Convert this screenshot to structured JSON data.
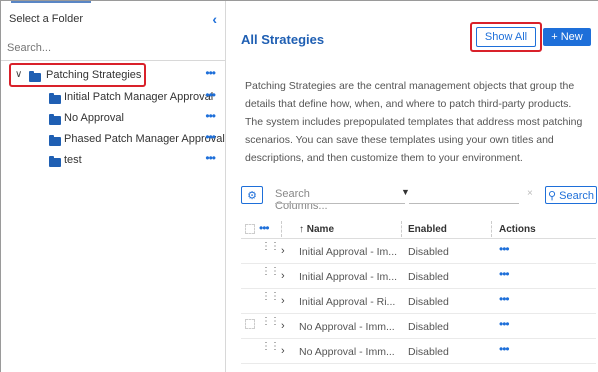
{
  "sidebar": {
    "title": "Select a Folder",
    "collapse_icon": "chevron-left-icon",
    "search_placeholder": "Search...",
    "root": {
      "label": "Patching Strategies",
      "expanded": true
    },
    "children": [
      {
        "label": "Initial Patch Manager Approval"
      },
      {
        "label": "No Approval"
      },
      {
        "label": "Phased Patch Manager Approval"
      },
      {
        "label": "test"
      }
    ],
    "more_glyph": "•••"
  },
  "main": {
    "title": "All Strategies",
    "show_all_label": "Show All",
    "new_label": "+ New",
    "description": "Patching Strategies are the central management objects that group the details that define how, when, and where to patch third-party products. The system includes prepopulated templates that address most patching scenarios. You can save these templates using your own titles and descriptions, and then customize them to your environment.",
    "toolbar": {
      "settings_icon": "gear-icon",
      "column_search_placeholder": "Search Columns...",
      "clear_glyph": "×",
      "search_label": "Search"
    },
    "grid": {
      "columns": {
        "name": "↑ Name",
        "enabled": "Enabled",
        "actions": "Actions"
      },
      "rows": [
        {
          "name": "Initial Approval - Im...",
          "enabled": "Disabled"
        },
        {
          "name": "Initial Approval - Im...",
          "enabled": "Disabled"
        },
        {
          "name": "Initial Approval - Ri...",
          "enabled": "Disabled"
        },
        {
          "name": "No Approval - Imm...",
          "enabled": "Disabled"
        },
        {
          "name": "No Approval - Imm...",
          "enabled": "Disabled"
        }
      ]
    }
  },
  "colors": {
    "accent": "#1e6fd9",
    "folder": "#1f5fb3",
    "highlight": "#d9212a"
  }
}
